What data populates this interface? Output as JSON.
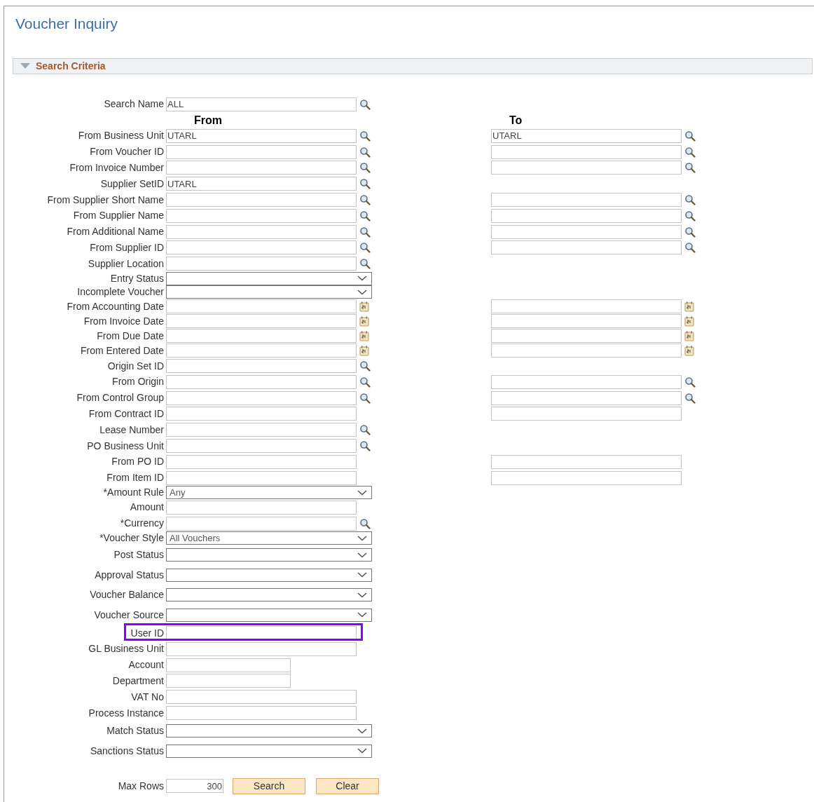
{
  "page_title": "Voucher Inquiry",
  "section": {
    "title": "Search Criteria",
    "expanded": true
  },
  "search_name": {
    "label": "Search Name",
    "value": "ALL"
  },
  "column_headers": {
    "from": "From",
    "to": "To"
  },
  "rows": [
    {
      "label": "From Business Unit",
      "kind": "lookup",
      "value": "UTARL",
      "to": {
        "kind": "lookup",
        "value": "UTARL"
      }
    },
    {
      "label": "From Voucher ID",
      "kind": "lookup",
      "to": {
        "kind": "lookup"
      }
    },
    {
      "label": "From Invoice Number",
      "kind": "lookup",
      "to": {
        "kind": "lookup"
      }
    },
    {
      "label": "Supplier SetID",
      "kind": "lookup",
      "value": "UTARL"
    },
    {
      "label": "From Supplier Short Name",
      "kind": "lookup",
      "to": {
        "kind": "lookup"
      }
    },
    {
      "label": "From Supplier Name",
      "kind": "lookup",
      "to": {
        "kind": "lookup"
      }
    },
    {
      "label": "From Additional Name",
      "kind": "lookup",
      "to": {
        "kind": "lookup"
      }
    },
    {
      "label": "From Supplier ID",
      "kind": "lookup",
      "to": {
        "kind": "lookup"
      }
    },
    {
      "label": "Supplier Location",
      "kind": "lookup"
    },
    {
      "label": "Entry Status",
      "kind": "select"
    },
    {
      "label": "Incomplete Voucher",
      "kind": "select"
    },
    {
      "label": "From Accounting Date",
      "kind": "date",
      "to": {
        "kind": "date"
      }
    },
    {
      "label": "From Invoice Date",
      "kind": "date",
      "to": {
        "kind": "date"
      }
    },
    {
      "label": "From Due Date",
      "kind": "date",
      "to": {
        "kind": "date"
      }
    },
    {
      "label": "From Entered Date",
      "kind": "date",
      "to": {
        "kind": "date"
      }
    },
    {
      "label": "Origin Set ID",
      "kind": "lookup"
    },
    {
      "label": "From Origin",
      "kind": "lookup",
      "to": {
        "kind": "lookup"
      }
    },
    {
      "label": "From Control Group",
      "kind": "lookup",
      "to": {
        "kind": "lookup"
      }
    },
    {
      "label": "From Contract ID",
      "kind": "text",
      "to": {
        "kind": "text"
      }
    },
    {
      "label": "Lease Number",
      "kind": "lookup"
    },
    {
      "label": "PO Business Unit",
      "kind": "lookup"
    },
    {
      "label": "From PO ID",
      "kind": "text",
      "to": {
        "kind": "text"
      }
    },
    {
      "label": "From Item ID",
      "kind": "text",
      "to": {
        "kind": "text"
      }
    },
    {
      "label": "*Amount Rule",
      "kind": "select",
      "value": "Any"
    },
    {
      "label": "Amount",
      "kind": "text"
    },
    {
      "label": "*Currency",
      "kind": "lookup"
    },
    {
      "label": "*Voucher Style",
      "kind": "select",
      "value": "All Vouchers"
    },
    {
      "label": "Post Status",
      "kind": "select"
    },
    {
      "label": "Approval Status",
      "kind": "select"
    },
    {
      "label": "Voucher Balance",
      "kind": "select"
    },
    {
      "label": "Voucher Source",
      "kind": "select"
    },
    {
      "label": "User ID",
      "kind": "text",
      "highlighted": true
    },
    {
      "label": "GL Business Unit",
      "kind": "text"
    },
    {
      "label": "Account",
      "kind": "short"
    },
    {
      "label": "Department",
      "kind": "short"
    },
    {
      "label": "VAT No",
      "kind": "text"
    },
    {
      "label": "Process Instance",
      "kind": "text"
    },
    {
      "label": "Match Status",
      "kind": "select"
    },
    {
      "label": "Sanctions Status",
      "kind": "select"
    }
  ],
  "max_rows": {
    "label": "Max Rows",
    "value": "300"
  },
  "buttons": [
    "Search",
    "Clear"
  ]
}
